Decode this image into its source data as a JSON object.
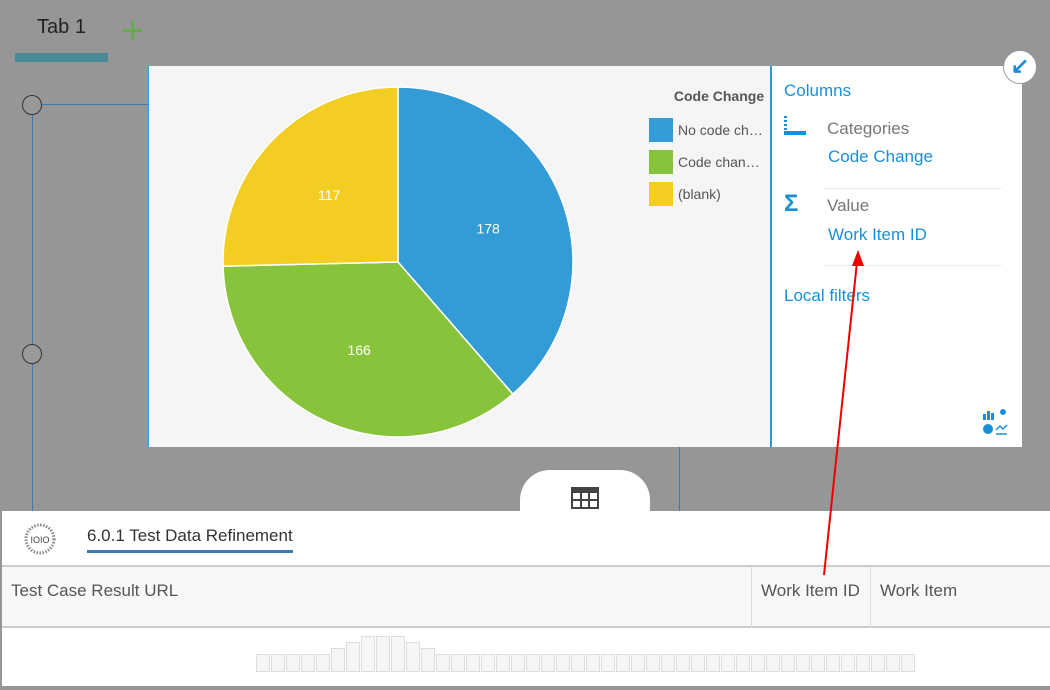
{
  "tabs": [
    {
      "label": "Tab 1"
    }
  ],
  "add_tab_icon": "plus-icon",
  "chart_data": {
    "type": "pie",
    "title": "Code Change",
    "categories": [
      "No code ch…",
      "Code chan…",
      "(blank)"
    ],
    "values": [
      178,
      166,
      117
    ],
    "colors": [
      "#339cd6",
      "#88c43b",
      "#f4cd22"
    ]
  },
  "side_panel": {
    "columns_label": "Columns",
    "categories_label": "Categories",
    "categories_value": "Code Change",
    "value_label": "Value",
    "value_value": "Work Item ID",
    "local_filters_label": "Local filters"
  },
  "bottom": {
    "title": "6.0.1 Test Data Refinement",
    "columns": [
      "Test Case Result URL",
      "Work Item ID",
      "Work Item"
    ]
  },
  "loading_bars": [
    1,
    1,
    1,
    1,
    1,
    2,
    3,
    4,
    4,
    4,
    3,
    2,
    1,
    1,
    1,
    1,
    1,
    1,
    1,
    1,
    1,
    1,
    1,
    1,
    1,
    1,
    1,
    1,
    1,
    1,
    1,
    1,
    1,
    1,
    1,
    1,
    1,
    1,
    1,
    1,
    1,
    1,
    1,
    1
  ]
}
